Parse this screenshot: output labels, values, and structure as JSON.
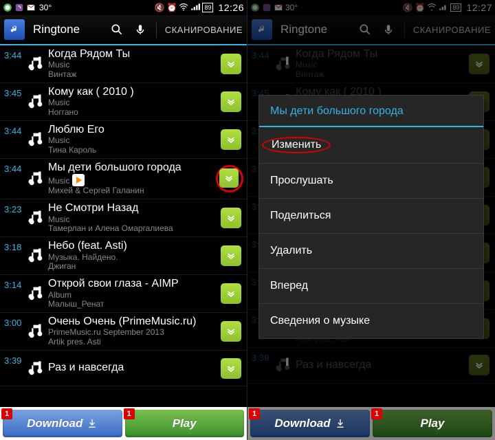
{
  "status": {
    "temp": "30°",
    "batt": "89",
    "time_left": "12:26",
    "time_right": "12:27"
  },
  "appbar": {
    "title": "Ringtone",
    "scan": "СКАНИРОВАНИЕ"
  },
  "songs": [
    {
      "dur": "3:44",
      "title": "Когда Рядом Ты",
      "sub1": "Music",
      "sub2": "Винтаж"
    },
    {
      "dur": "3:45",
      "title": "Кому как ( 2010 )",
      "sub1": "Music",
      "sub2": "Ноггано"
    },
    {
      "dur": "3:44",
      "title": "Люблю Его",
      "sub1": "Music",
      "sub2": "Тина Кароль"
    },
    {
      "dur": "3:44",
      "title": "Мы дети большого города",
      "sub1": "Music",
      "sub2": "Михей & Сергей Галанин",
      "playing": true,
      "circled": true
    },
    {
      "dur": "3:23",
      "title": "Не Смотри Назад",
      "sub1": "Music",
      "sub2": "Тамерлан и Алена Омаргалиева"
    },
    {
      "dur": "3:18",
      "title": "Небо (feat. Asti)",
      "sub1": "Музыка. Найдено.",
      "sub2": "Джиган"
    },
    {
      "dur": "3:14",
      "title": "Открой свои глаза - AIMP",
      "sub1": "Album",
      "sub2": "Малыш_Ренат"
    },
    {
      "dur": "3:00",
      "title": "Очень Очень (PrimeMusic.ru)",
      "sub1": "PrimeMusic.ru September 2013",
      "sub2": "Artik pres. Asti"
    },
    {
      "dur": "3:39",
      "title": "Раз и навсегда",
      "sub1": "",
      "sub2": ""
    }
  ],
  "dialog": {
    "title": "Мы дети большого города",
    "items": [
      "Изменить",
      "Прослушать",
      "Поделиться",
      "Удалить",
      "Вперед",
      "Сведения о музыке"
    ]
  },
  "bottom": {
    "download": "Download",
    "play": "Play",
    "badge": "1"
  }
}
